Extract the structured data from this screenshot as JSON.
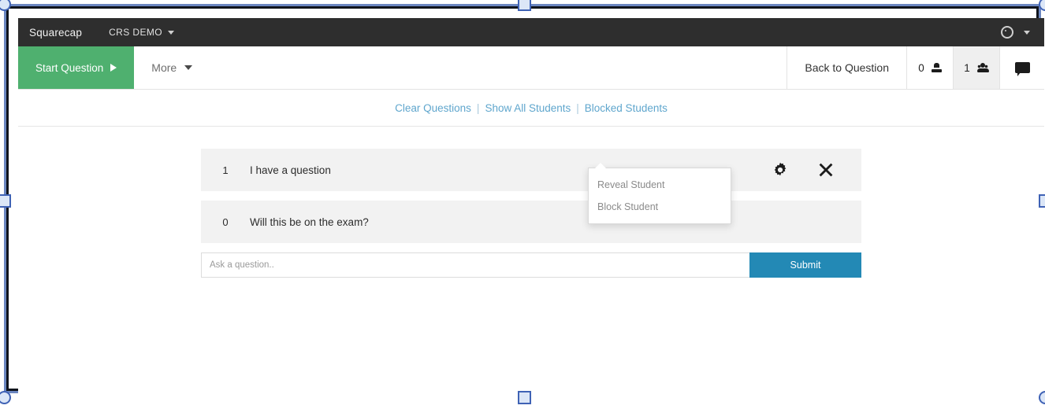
{
  "navbar": {
    "brand": "Squarecap",
    "course": "CRS DEMO",
    "settings_icon": "gear-icon",
    "caret_icon": "chevron-down-icon"
  },
  "toolbar": {
    "start_question_label": "Start Question",
    "start_question_icon": "play-icon",
    "more_label": "More",
    "back_to_question_label": "Back to Question",
    "hand_count": "0",
    "hand_icon": "hand-raise-icon",
    "people_count": "1",
    "people_icon": "people-icon",
    "chat_icon": "chat-bubble-icon"
  },
  "links": {
    "clear_questions": "Clear Questions",
    "separator": "|",
    "show_all_students": "Show All Students",
    "blocked_students": "Blocked Students"
  },
  "questions": [
    {
      "votes": "1",
      "text": "I have a question"
    },
    {
      "votes": "0",
      "text": "Will this be on the exam?"
    }
  ],
  "dropdown": {
    "reveal_student": "Reveal Student",
    "block_student": "Block Student"
  },
  "ask": {
    "placeholder": "Ask a question..",
    "value": "",
    "submit_label": "Submit"
  },
  "colors": {
    "navbar_bg": "#2e2e2e",
    "start_green": "#4fb06f",
    "submit_blue": "#2389b5",
    "link_blue": "#5fa6cd",
    "row_gray": "#f2f2f2",
    "selection_blue": "#3f62b5"
  }
}
